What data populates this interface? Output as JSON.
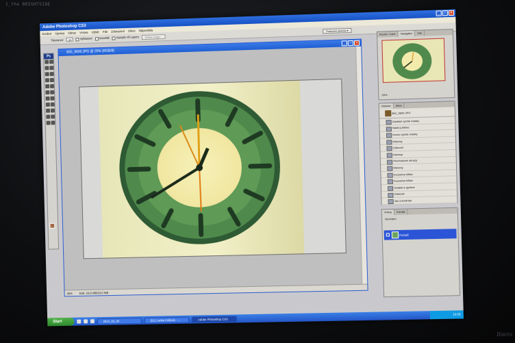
{
  "bezel": {
    "label": "1_the BRIGHTSIDE"
  },
  "app": {
    "title": "Adobe Photoshop CS3"
  },
  "menu": [
    "Soubor",
    "Úpravy",
    "Obraz",
    "Vrstva",
    "Výběr",
    "Filtr",
    "Zobrazení",
    "Okno",
    "Nápověda"
  ],
  "options": {
    "tolerance_label": "Tolerance:",
    "tolerance_value": "30",
    "antialias": "Vyhlazení",
    "contiguous": "Souvislé",
    "sample_all": "Sample All Layers",
    "refine_edge": "Refine Edge...",
    "workspace": "Pracovní plocha ▾"
  },
  "document": {
    "title": "BIG_9600.JPG @ 25% (RGB/8)",
    "zoom": "25%",
    "doc_size": "Dok: 23,0 MB/23,0 MB"
  },
  "navigator": {
    "tabs": [
      "Rozšíř. Color",
      "Navigátor",
      "Info"
    ],
    "active_tab": 1,
    "zoom": "25%"
  },
  "history": {
    "tabs": [
      "Historie",
      "Akce"
    ],
    "snapshot": "BIG_9600.JPG",
    "items": [
      "Začátek rychlé masky",
      "Nástroj štětec",
      "Konec rychlé masky",
      "Klávesy",
      "Odkrovit",
      "Klávesy",
      "Přechodové obrazy",
      "Klávesy",
      "Kouzelná hůlka",
      "Kouzelná hůlka",
      "Oddělit a sjednot",
      "Odkrovit",
      "Jas a kontrast",
      "Selektivní barva"
    ]
  },
  "layers": {
    "tabs": [
      "Vrstvy",
      "Kanály"
    ],
    "blend_label": "Normální",
    "layer_name": "Pozadí"
  },
  "taskbar": {
    "start": "Start",
    "items": [
      "2014_03_30",
      "(51) Lenka Hášová - ...",
      "Adobe Photoshop CS3"
    ],
    "active": 2,
    "clock": "10:05"
  },
  "corner_logo": "Biarmi"
}
